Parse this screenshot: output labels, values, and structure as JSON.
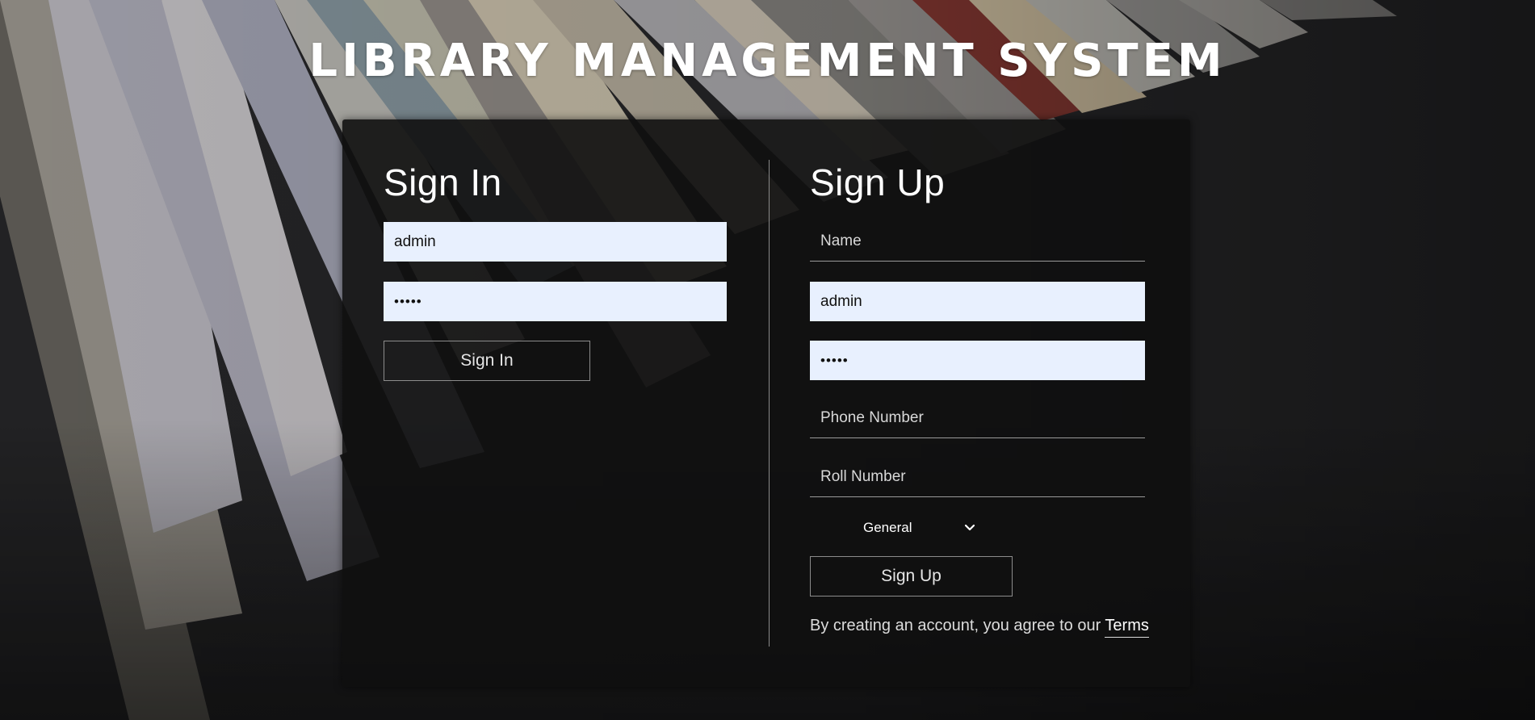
{
  "app_title": "LIBRARY MANAGEMENT SYSTEM",
  "colors": {
    "panel_bg": "#101010",
    "filled_input_bg": "#e8f0fe",
    "text": "#ffffff"
  },
  "sign_in": {
    "heading": "Sign In",
    "username_value": "admin",
    "password_value": "•••••",
    "button_label": "Sign In"
  },
  "sign_up": {
    "heading": "Sign Up",
    "name_placeholder": "Name",
    "username_value": "admin",
    "password_value": "•••••",
    "phone_placeholder": "Phone Number",
    "roll_placeholder": "Roll Number",
    "category_selected": "General",
    "button_label": "Sign Up",
    "terms_text": "By creating an account, you agree to our ",
    "terms_link": "Terms"
  },
  "icons": {
    "select_chevron": "chevron-down-icon"
  }
}
